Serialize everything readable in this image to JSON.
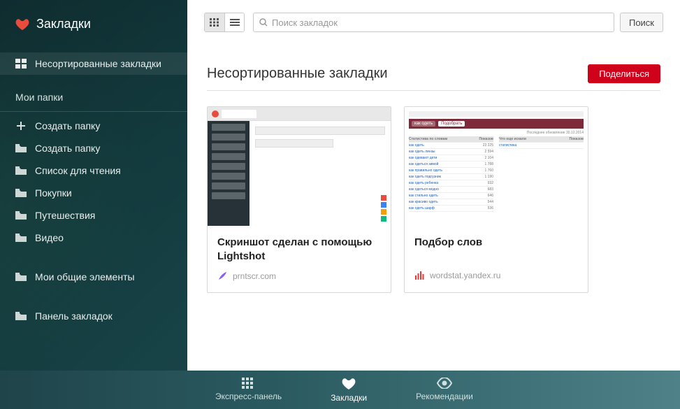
{
  "sidebar": {
    "title": "Закладки",
    "active_label": "Несортированные закладки",
    "folders_label": "Мои папки",
    "create_plus_label": "Создать папку",
    "folders": [
      {
        "label": "Создать папку"
      },
      {
        "label": "Список для чтения"
      },
      {
        "label": "Покупки"
      },
      {
        "label": "Путешествия"
      },
      {
        "label": "Видео"
      }
    ],
    "shared_label": "Мои общие элементы",
    "bookmarks_panel_label": "Панель закладок"
  },
  "toolbar": {
    "search_placeholder": "Поиск закладок",
    "search_button": "Поиск"
  },
  "main": {
    "heading": "Несортированные закладки",
    "share_button": "Поделиться",
    "cards": [
      {
        "title": "Скриншот сделан с помощью Lightshot",
        "domain": "prntscr.com"
      },
      {
        "title": "Подбор слов",
        "domain": "wordstat.yandex.ru"
      }
    ]
  },
  "bottomnav": {
    "express": "Экспресс-панель",
    "bookmarks": "Закладки",
    "recommendations": "Рекомендации"
  }
}
